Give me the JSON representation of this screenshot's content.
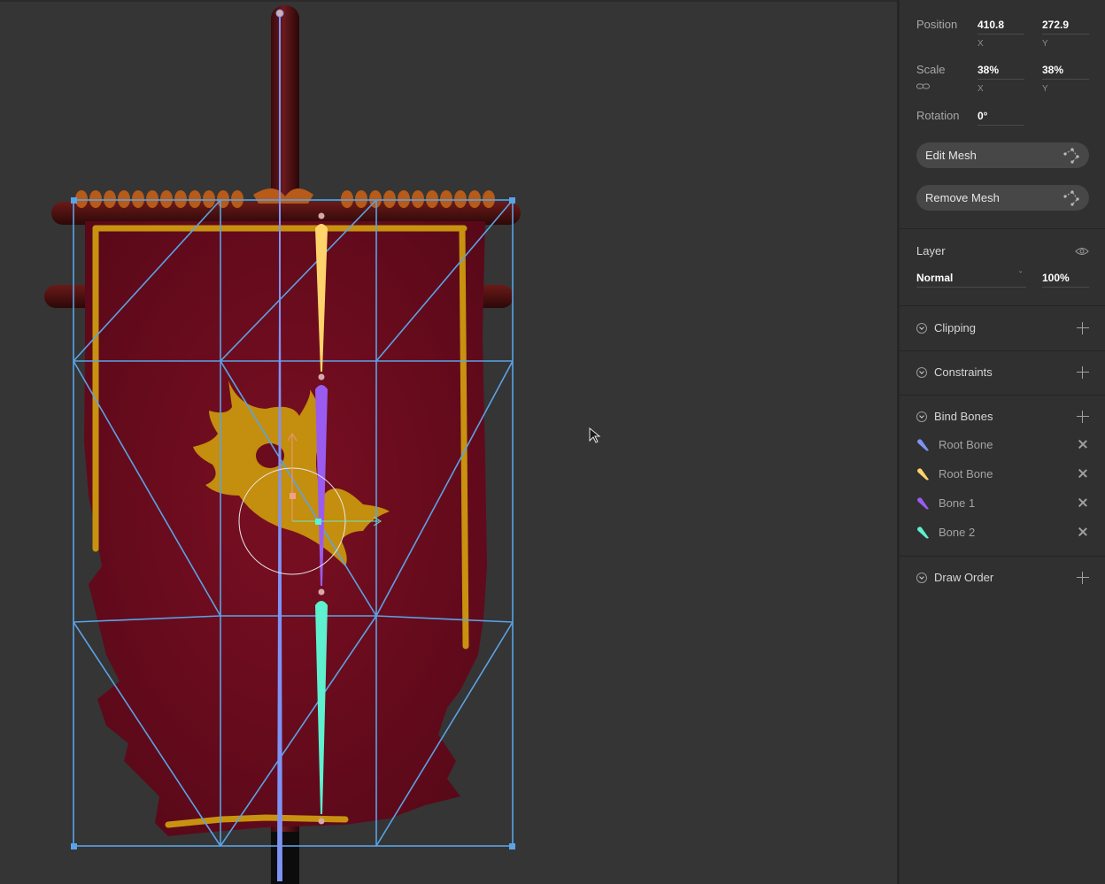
{
  "transform": {
    "position_label": "Position",
    "position_x": "410.8",
    "position_y": "272.9",
    "x_label": "X",
    "y_label": "Y",
    "scale_label": "Scale",
    "scale_x": "38%",
    "scale_y": "38%",
    "rotation_label": "Rotation",
    "rotation_value": "0°"
  },
  "mesh": {
    "edit_label": "Edit Mesh",
    "remove_label": "Remove Mesh"
  },
  "layer": {
    "label": "Layer",
    "blend_mode": "Normal",
    "opacity": "100%"
  },
  "sections": {
    "clipping": "Clipping",
    "constraints": "Constraints",
    "bind_bones": "Bind Bones",
    "draw_order": "Draw Order"
  },
  "bones": [
    {
      "name": "Root Bone",
      "color": "#7f93f5"
    },
    {
      "name": "Root Bone",
      "color": "#ffd36b"
    },
    {
      "name": "Bone 1",
      "color": "#9a5cf0"
    },
    {
      "name": "Bone 2",
      "color": "#5ef0cf"
    }
  ],
  "colors": {
    "mesh": "#5aa3e6",
    "banner": "#6e0c1e",
    "gold": "#c89210"
  }
}
